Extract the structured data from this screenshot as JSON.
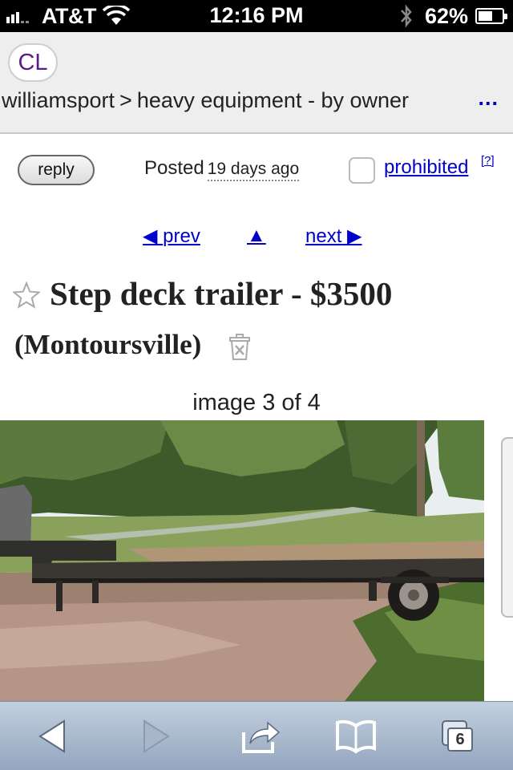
{
  "status_bar": {
    "carrier": "AT&T",
    "time": "12:16 PM",
    "battery_percent": "62%",
    "battery_level": 0.62
  },
  "header": {
    "logo": "CL",
    "breadcrumb": {
      "location": "williamsport",
      "separator": ">",
      "category": "heavy equipment - by owner"
    },
    "more": "..."
  },
  "posting": {
    "reply_label": "reply",
    "posted_label": "Posted",
    "posted_ago": "19 days ago",
    "flag_label": "prohibited",
    "flag_help": "[?]"
  },
  "nav": {
    "prev_label": "prev",
    "up_label": "▲",
    "next_label": "next"
  },
  "listing": {
    "title": "Step deck trailer - $3500",
    "location": "(Montoursville)",
    "image_counter": "image 3 of 4"
  },
  "toolbar": {
    "icons": [
      "back-arrow-icon",
      "forward-arrow-icon",
      "share-icon",
      "bookmarks-icon",
      "tabs-icon"
    ],
    "tab_count": "6"
  },
  "colors": {
    "link": "#0000cc",
    "logo": "#5a1a8a",
    "header_bg": "#eeeeee",
    "toolbar_top": "#c3cfdd",
    "toolbar_bottom": "#93a6bf"
  }
}
